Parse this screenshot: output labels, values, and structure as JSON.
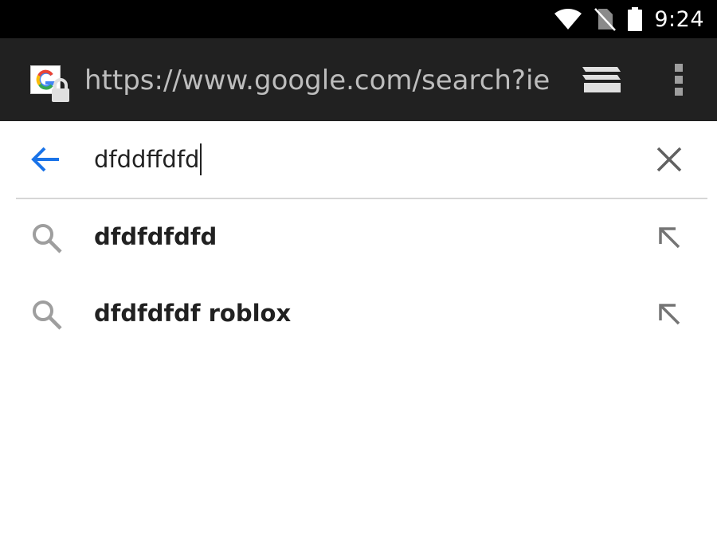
{
  "status_bar": {
    "time": "9:24",
    "icons": [
      "wifi-icon",
      "no-sim-icon",
      "battery-icon"
    ]
  },
  "toolbar": {
    "url": "https://www.google.com/search?ie=",
    "site_icon": "google-secure-icon",
    "tabs_icon": "tab-switcher-icon",
    "menu_icon": "overflow-menu-icon"
  },
  "search": {
    "query": "dfddffdfd",
    "back_icon": "back-arrow-icon",
    "clear_icon": "close-icon"
  },
  "suggestions": [
    {
      "text": "dfdfdfdfd",
      "icon": "search-icon",
      "action_icon": "arrow-up-left-icon"
    },
    {
      "text": "dfdfdfdf roblox",
      "icon": "search-icon",
      "action_icon": "arrow-up-left-icon"
    }
  ],
  "colors": {
    "status_bar": "#000000",
    "toolbar": "#212121",
    "url_text": "#bdbdbd",
    "accent": "#1a73e8",
    "icon_gray": "#757575"
  }
}
